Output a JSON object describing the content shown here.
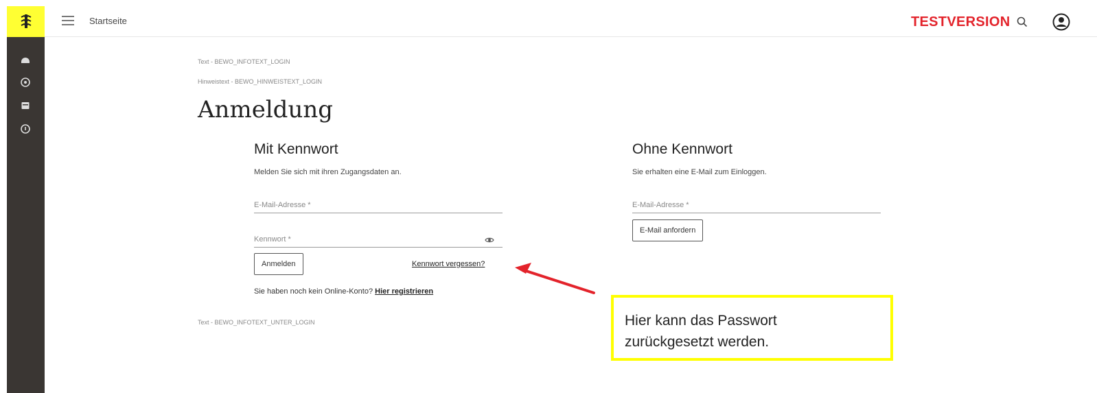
{
  "header": {
    "breadcrumb_home": "Startseite",
    "testversion_label": "TESTVERSION",
    "brand_color": "#ffff33",
    "accent_color": "#e3232b"
  },
  "sidebar": {
    "items": [
      {
        "icon": "dashboard-icon"
      },
      {
        "icon": "compass-icon"
      },
      {
        "icon": "inbox-icon"
      },
      {
        "icon": "info-icon"
      }
    ]
  },
  "main": {
    "info_top": "Text - BEWO_INFOTEXT_LOGIN",
    "info_hint": "Hinweistext - BEWO_HINWEISTEXT_LOGIN",
    "heading": "Anmeldung",
    "with_password": {
      "title": "Mit Kennwort",
      "subtitle": "Melden Sie sich mit ihren Zugangsdaten an.",
      "email_placeholder": "E-Mail-Adresse *",
      "password_placeholder": "Kennwort *",
      "login_button": "Anmelden",
      "forgot_link": "Kennwort vergessen?",
      "no_account_text": "Sie haben noch kein Online-Konto?",
      "register_link": "Hier registrieren"
    },
    "without_password": {
      "title": "Ohne Kennwort",
      "subtitle": "Sie erhalten eine E-Mail zum Einloggen.",
      "email_placeholder": "E-Mail-Adresse *",
      "request_button": "E-Mail anfordern"
    },
    "info_bottom": "Text - BEWO_INFOTEXT_UNTER_LOGIN"
  },
  "annotation": {
    "text_line1": "Hier kann das Passwort",
    "text_line2": "zurückgesetzt werden.",
    "border_color": "#ffff00",
    "arrow_color": "#e3232b"
  }
}
